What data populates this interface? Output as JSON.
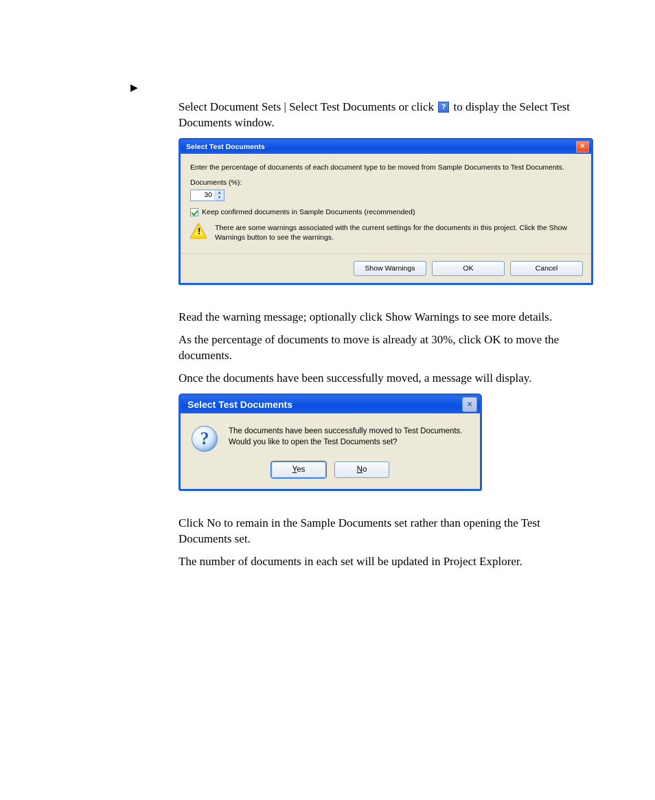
{
  "doc": {
    "p1a": "Select Document Sets | Select Test Documents or click ",
    "p1b": " to display the Select Test Documents window.",
    "p2": "Read the warning message; optionally click Show Warnings to see more details.",
    "p3": "As the percentage of documents to move is already at 30%, click OK to move the documents.",
    "p4": "Once the documents have been successfully moved, a message will display.",
    "p5": "Click No to remain in the Sample Documents set rather than opening the Test Documents set.",
    "p6": "The number of documents in each set will be updated in Project Explorer."
  },
  "dialog1": {
    "title": "Select Test Documents",
    "instruction": "Enter the percentage of documents of each document type to be moved from Sample Documents to Test Documents.",
    "percent_label": "Documents (%):",
    "percent_value": "30",
    "checkbox_label": "Keep confirmed documents in Sample Documents (recommended)",
    "checkbox_checked": true,
    "warning_text": "There are some warnings associated with the current settings for the documents in this project. Click the Show Warnings button to see the warnings.",
    "btn_show": "Show Warnings",
    "btn_ok": "OK",
    "btn_cancel": "Cancel"
  },
  "dialog2": {
    "title": "Select Test Documents",
    "line1": "The documents have been successfully moved to Test Documents.",
    "line2": "Would you like to open the Test Documents set?",
    "btn_yes": "Yes",
    "btn_no": "No"
  }
}
